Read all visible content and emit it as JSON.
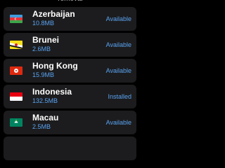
{
  "header": {
    "text": "removal"
  },
  "colors": {
    "background": "#000000",
    "row_bg": "#1c1c1e",
    "accent": "#5aa3f0",
    "text": "#ffffff"
  },
  "regions": [
    {
      "name": "Azerbaijan",
      "size": "10.8MB",
      "status": "Available",
      "flag": "azerbaijan-flag-icon"
    },
    {
      "name": "Brunei",
      "size": "2.6MB",
      "status": "Available",
      "flag": "brunei-flag-icon"
    },
    {
      "name": "Hong Kong",
      "size": "15.9MB",
      "status": "Available",
      "flag": "hong-kong-flag-icon"
    },
    {
      "name": "Indonesia",
      "size": "132.5MB",
      "status": "Installed",
      "flag": "indonesia-flag-icon"
    },
    {
      "name": "Macau",
      "size": "2.5MB",
      "status": "Available",
      "flag": "macau-flag-icon"
    }
  ]
}
